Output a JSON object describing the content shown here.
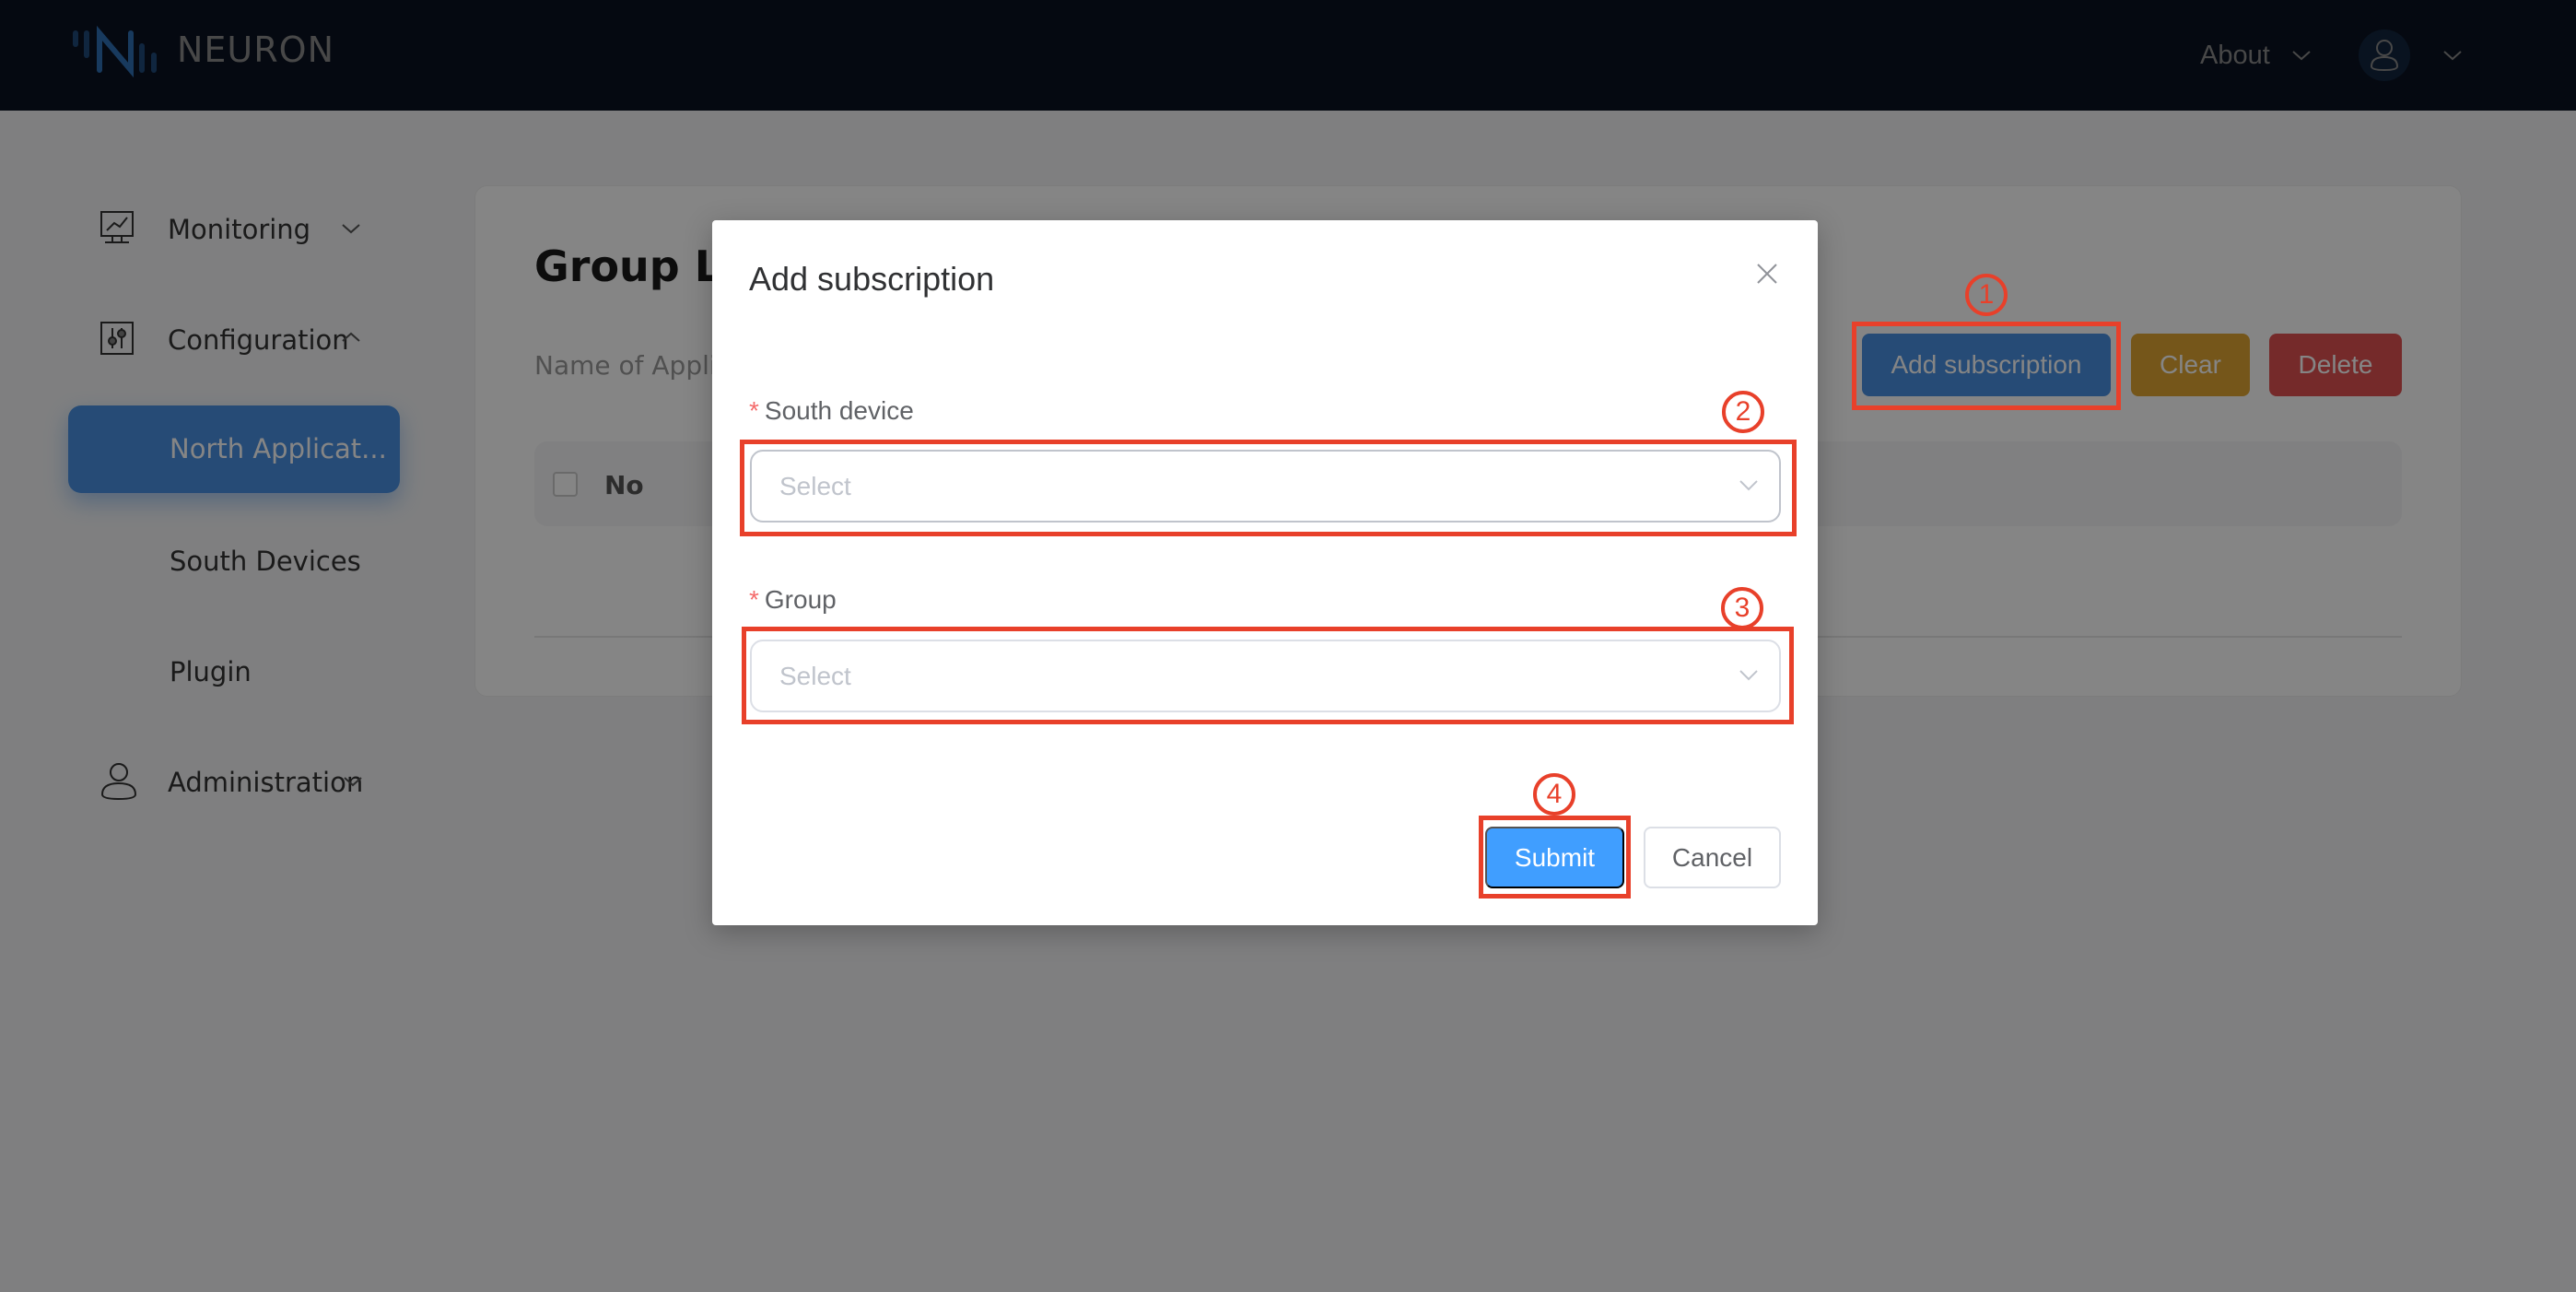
{
  "header": {
    "brand": "NEURON",
    "about_label": "About",
    "icons": {
      "logo": "neuron-logo-icon",
      "about_chevron": "chevron-down-icon",
      "avatar": "user-icon",
      "user_chevron": "chevron-down-icon"
    }
  },
  "sidebar": {
    "items": [
      {
        "label": "Monitoring",
        "icon": "monitor-chart-icon",
        "chevron": "chevron-down-icon"
      },
      {
        "label": "Configuration",
        "icon": "sliders-icon",
        "chevron": "chevron-up-icon"
      },
      {
        "label": "North Applicat...",
        "active": true
      },
      {
        "label": "South Devices"
      },
      {
        "label": "Plugin"
      },
      {
        "label": "Administration",
        "icon": "user-icon",
        "chevron": "chevron-down-icon"
      }
    ]
  },
  "page": {
    "title": "Group List",
    "subtitle": "Name of Application",
    "buttons": {
      "add": "Add subscription",
      "clear": "Clear",
      "delete": "Delete"
    },
    "table": {
      "columns": [
        "No"
      ]
    }
  },
  "modal": {
    "title": "Add subscription",
    "fields": [
      {
        "label": "South device",
        "required_mark": "*",
        "placeholder": "Select"
      },
      {
        "label": "Group",
        "required_mark": "*",
        "placeholder": "Select"
      }
    ],
    "submit_label": "Submit",
    "cancel_label": "Cancel"
  },
  "annotations": [
    "1",
    "2",
    "3",
    "4"
  ],
  "colors": {
    "header_bg": "#0b1321",
    "primary": "#409eff",
    "sidebar_active": "#4a90e2",
    "clear": "#e0a532",
    "delete": "#e05252",
    "annotation": "#e8402a",
    "required": "#f56c6c"
  }
}
